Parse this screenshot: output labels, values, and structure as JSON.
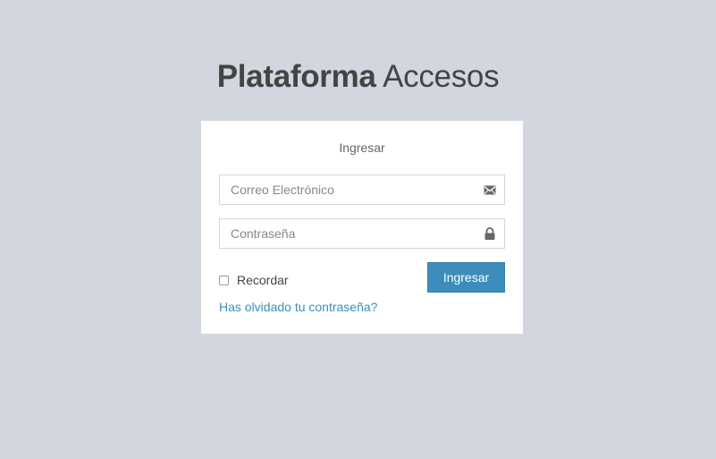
{
  "logo": {
    "bold": "Plataforma",
    "light": "Accesos"
  },
  "login": {
    "title": "Ingresar",
    "email_placeholder": "Correo Electrónico",
    "email_value": "",
    "email_icon": "envelope-icon",
    "password_placeholder": "Contraseña",
    "password_value": "",
    "password_icon": "lock-icon",
    "remember_label": "Recordar",
    "remember_checked": false,
    "submit_label": "Ingresar",
    "forgot_label": "Has olvidado tu contraseña?"
  },
  "colors": {
    "background": "#d2d6de",
    "primary": "#3c8dbc",
    "text": "#444444"
  }
}
